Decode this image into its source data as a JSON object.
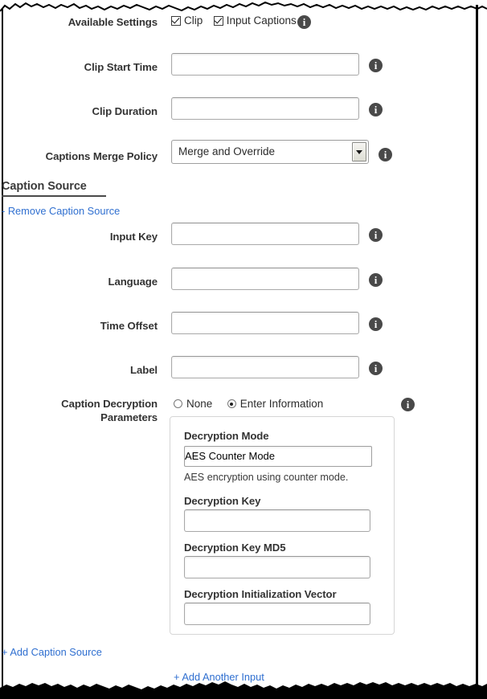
{
  "form": {
    "available_settings": {
      "label": "Available Settings",
      "checkboxes": [
        {
          "label": "Clip",
          "checked": true
        },
        {
          "label": "Input Captions",
          "checked": true
        }
      ],
      "info": "i"
    },
    "clip_start_time": {
      "label": "Clip Start Time",
      "value": "",
      "placeholder": "",
      "info": "i"
    },
    "clip_duration": {
      "label": "Clip Duration",
      "value": "",
      "placeholder": "",
      "info": "i"
    },
    "captions_merge_policy": {
      "label": "Captions Merge Policy",
      "value": "Merge and Override",
      "options": [
        "Merge and Override"
      ],
      "info": "i"
    }
  },
  "caption_source": {
    "heading": "Caption Source",
    "remove_link": "- Remove Caption Source",
    "add_link": "+ Add Caption Source",
    "input_key": {
      "label": "Input Key",
      "value": "",
      "placeholder": "",
      "info": "i"
    },
    "language": {
      "label": "Language",
      "value": "",
      "placeholder": "",
      "info": "i"
    },
    "time_offset": {
      "label": "Time Offset",
      "value": "",
      "placeholder": "",
      "info": "i"
    },
    "label_field": {
      "label": "Label",
      "value": "",
      "placeholder": "",
      "info": "i"
    }
  },
  "caption_decryption": {
    "label_line1": "Caption Decryption",
    "label_line2": "Parameters",
    "info": "i",
    "radios": [
      {
        "label": "None",
        "selected": false
      },
      {
        "label": "Enter Information",
        "selected": true
      }
    ],
    "panel": {
      "decryption_mode": {
        "label": "Decryption Mode",
        "value": "AES Counter Mode",
        "options": [
          "AES Counter Mode"
        ],
        "help": "AES encryption using counter mode."
      },
      "decryption_key": {
        "label": "Decryption Key",
        "value": "",
        "placeholder": ""
      },
      "decryption_key_md5": {
        "label": "Decryption Key MD5",
        "value": "",
        "placeholder": ""
      },
      "decryption_iv": {
        "label": "Decryption Initialization Vector",
        "value": "",
        "placeholder": ""
      }
    }
  },
  "footer": {
    "add_another_input": "+ Add Another Input"
  },
  "colors": {
    "link": "#2f6fd0",
    "label_text": "#333333",
    "info_badge": "#494949",
    "field_border": "#aaaaaa"
  }
}
